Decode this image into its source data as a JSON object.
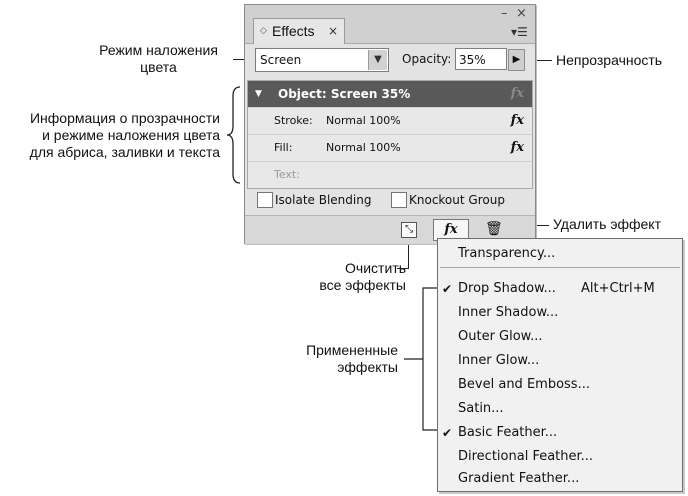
{
  "callouts": {
    "blend_mode": [
      "Режим наложения",
      "цвета"
    ],
    "opacity": "Непрозрачность",
    "info": [
      "Информация о прозрачности",
      "и режиме наложения цвета",
      "для абриса, заливки и текста"
    ],
    "delete_effect": "Удалить эффект",
    "clear_effects": [
      "Очистить",
      "все эффекты"
    ],
    "applied_effects": [
      "Примененные",
      "эффекты"
    ]
  },
  "panel": {
    "tab_title": "Effects",
    "tab_close": "×",
    "minimize": "–",
    "close": "×",
    "menu_icon": "▾☰",
    "blend_mode_value": "Screen",
    "opacity_label": "Opacity:",
    "opacity_value": "35%",
    "rows": [
      {
        "name": "Object: Screen 35%",
        "mode": ""
      },
      {
        "name": "Stroke:",
        "mode": "Normal 100%"
      },
      {
        "name": "Fill:",
        "mode": "Normal 100%"
      },
      {
        "name": "Text:",
        "mode": ""
      }
    ],
    "fx_glyph": "fx",
    "isolate_blending": "Isolate Blending",
    "knockout_group": "Knockout Group",
    "fx_button": "fx",
    "clear_glyph": "⤡",
    "trash_glyph": "🗑"
  },
  "menu": {
    "check": "✔",
    "items": [
      {
        "label": "Transparency...",
        "checked": false
      },
      {
        "label": "Drop Shadow...",
        "checked": true,
        "shortcut": "Alt+Ctrl+M"
      },
      {
        "label": "Inner Shadow...",
        "checked": false
      },
      {
        "label": "Outer Glow...",
        "checked": false
      },
      {
        "label": "Inner Glow...",
        "checked": false
      },
      {
        "label": "Bevel and Emboss...",
        "checked": false
      },
      {
        "label": "Satin...",
        "checked": false
      },
      {
        "label": "Basic Feather...",
        "checked": true
      },
      {
        "label": "Directional Feather...",
        "checked": false
      },
      {
        "label": "Gradient Feather...",
        "checked": false
      }
    ]
  }
}
